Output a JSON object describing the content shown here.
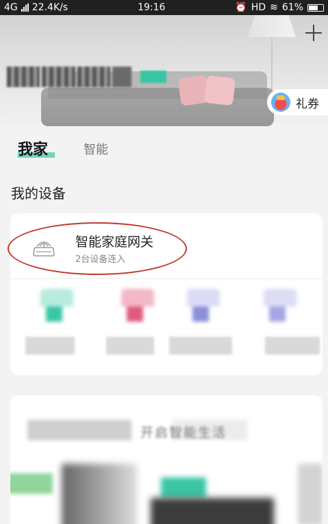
{
  "status_bar": {
    "network": "4G",
    "speed": "22.4K/s",
    "time": "19:16",
    "right": "HD",
    "battery": "61%"
  },
  "header": {
    "coupon_label": "礼券"
  },
  "tabs": {
    "home": "我家",
    "smart": "智能"
  },
  "section_title": "我的设备",
  "gateway": {
    "name": "智能家庭网关",
    "subtitle": "2台设备连入"
  },
  "devices": [
    {
      "icon": "device-thumb-green",
      "color": "#3ac6a5"
    },
    {
      "icon": "device-thumb-pink",
      "color": "#e05a7d"
    },
    {
      "icon": "device-thumb-purple",
      "color": "#8a8fd8"
    },
    {
      "icon": "device-thumb-blue",
      "color": "#a3a5e6"
    }
  ],
  "promo": {
    "text": "开启智能生活"
  },
  "colors": {
    "accent": "#3ac6a5",
    "annotation": "#c0392b"
  }
}
